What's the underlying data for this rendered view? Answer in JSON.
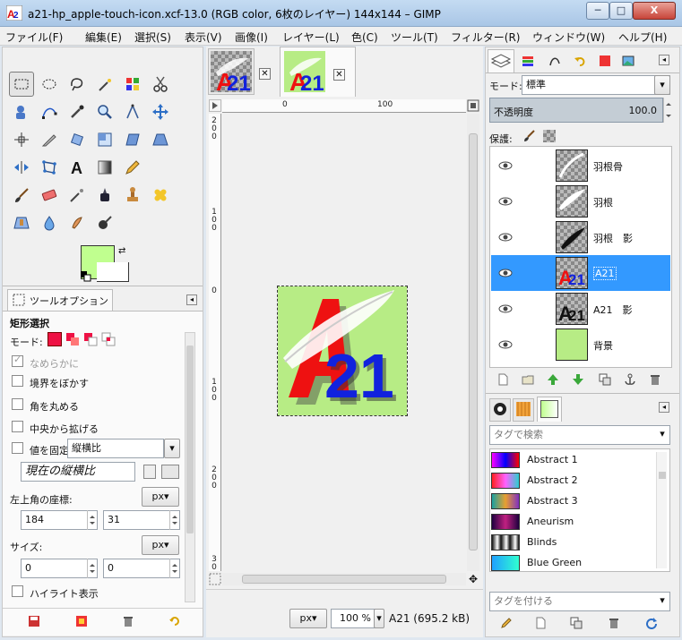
{
  "window": {
    "title": "a21-hp_apple-touch-icon.xcf-13.0 (RGB color, 6枚のレイヤー) 144x144 – GIMP",
    "min_label": "─",
    "max_label": "□",
    "close_label": "X"
  },
  "menu": [
    "ファイル(F)",
    "編集(E)",
    "選択(S)",
    "表示(V)",
    "画像(I)",
    "レイヤー(L)",
    "色(C)",
    "ツール(T)",
    "フィルター(R)",
    "ウィンドウ(W)",
    "ヘルプ(H)"
  ],
  "tool_options": {
    "tab_label": "ツールオプション",
    "tool_name": "矩形選択",
    "mode_label": "モード:",
    "antialias_label": "なめらかに",
    "feather_label": "境界をぼかす",
    "rounded_label": "角を丸める",
    "expand_label": "中央から拡げる",
    "fixed_label": "値を固定",
    "fixed_value": "縦横比",
    "ratio_value": "現在の縦横比",
    "position_label": "左上角の座標:",
    "position_unit": "px▾",
    "pos_x": "184",
    "pos_y": "31",
    "size_label": "サイズ:",
    "size_unit": "px▾",
    "size_w": "0",
    "size_h": "0",
    "highlight_label": "ハイライト表示"
  },
  "canvas": {
    "ruler_h": [
      "0",
      "100"
    ],
    "ruler_v_top": [
      "2",
      "0",
      "0"
    ],
    "ruler_v_1": [
      "1",
      "0",
      "0"
    ],
    "ruler_v_0": [
      "0"
    ],
    "ruler_v_100": [
      "1",
      "0",
      "0"
    ],
    "ruler_v_200": [
      "2",
      "0",
      "0"
    ],
    "ruler_v_300": [
      "3",
      "0",
      "0"
    ],
    "status_unit": "px▾",
    "zoom": "100 %",
    "status_text": "A21 (695.2 kB)",
    "logo_text": "21"
  },
  "layers": {
    "mode_label": "モード:",
    "mode_value": "標準",
    "opacity_label": "不透明度",
    "opacity_value": "100.0",
    "lock_label": "保護:",
    "items": [
      {
        "name": "羽根骨"
      },
      {
        "name": "羽根"
      },
      {
        "name": "羽根　影"
      },
      {
        "name": "A21"
      },
      {
        "name": "A21　影"
      },
      {
        "name": "背景"
      }
    ]
  },
  "gradients": {
    "tag_search_placeholder": "タグで検索",
    "items": [
      {
        "name": "Abstract 1"
      },
      {
        "name": "Abstract 2"
      },
      {
        "name": "Abstract 3"
      },
      {
        "name": "Aneurism"
      },
      {
        "name": "Blinds"
      },
      {
        "name": "Blue Green"
      }
    ],
    "tag_assign_placeholder": "タグを付ける"
  },
  "colors": {
    "foreground": "#c0ff8f",
    "background": "#ffffff",
    "selection": "#3399ff",
    "image_bg": "#b7ec85"
  }
}
